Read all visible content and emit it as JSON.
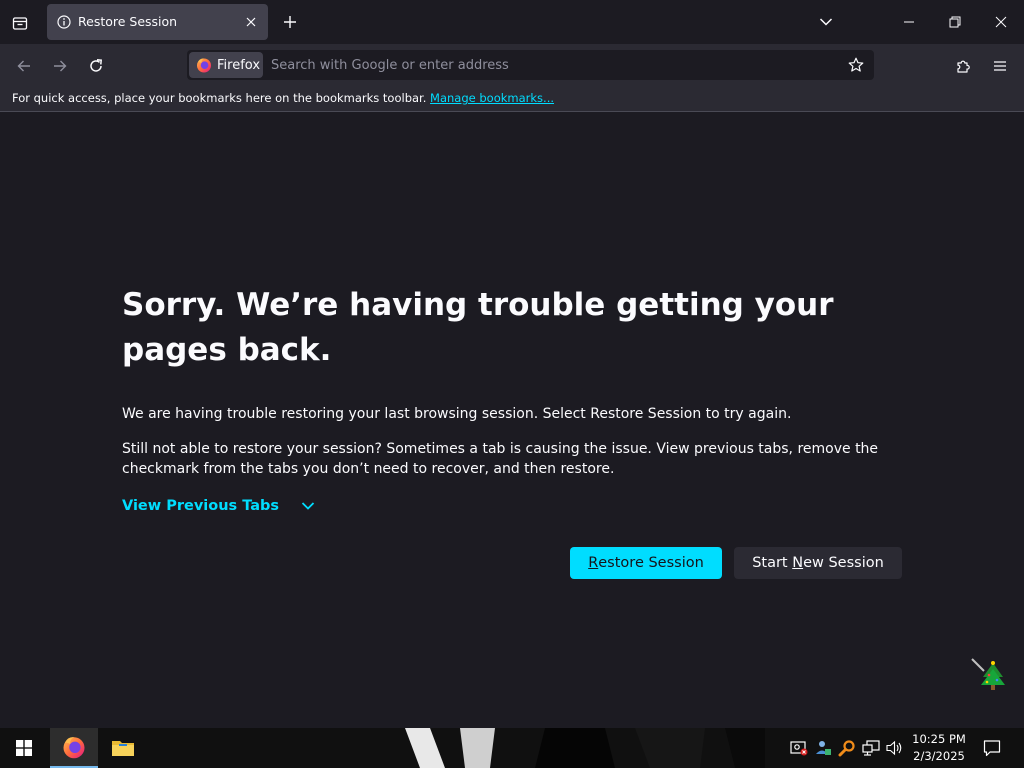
{
  "window": {
    "tab_title": "Restore Session"
  },
  "toolbar": {
    "identity_label": "Firefox",
    "url_placeholder": "Search with Google or enter address"
  },
  "bookmarks_bar": {
    "message": "For quick access, place your bookmarks here on the bookmarks toolbar.",
    "link_label": "Manage bookmarks..."
  },
  "page": {
    "heading": "Sorry. We’re having trouble getting your pages back.",
    "para1": "We are having trouble restoring your last browsing session. Select Restore Session to try again.",
    "para2": "Still not able to restore your session? Sometimes a tab is causing the issue. View previous tabs, remove the checkmark from the tabs you don’t need to recover, and then restore.",
    "view_previous_tabs": "View Previous Tabs",
    "restore_button": {
      "accesskey": "R",
      "rest": "estore Session"
    },
    "new_session_button": {
      "before": "Start ",
      "accesskey": "N",
      "rest": "ew Session"
    }
  },
  "taskbar": {
    "time": "10:25 PM",
    "date": "2/3/2025"
  },
  "colors": {
    "accent": "#00ddff",
    "page_bg": "#1c1b22",
    "toolbar_bg": "#2b2a33",
    "tab_selected_bg": "#42414d",
    "taskbar_bg": "#101010"
  },
  "icons": {
    "list_tabs": "list-all-tabs-icon",
    "tab_info": "info-icon",
    "tab_close": "close-icon",
    "new_tab": "plus-icon",
    "tab_overflow": "chevron-down-icon",
    "minimize": "minimize-icon",
    "restore": "restore-window-icon",
    "close_window": "close-icon",
    "back": "back-arrow-icon",
    "forward": "forward-arrow-icon",
    "reload": "reload-icon",
    "bookmark_star": "star-icon",
    "extensions": "puzzle-icon",
    "menu": "hamburger-menu-icon"
  }
}
